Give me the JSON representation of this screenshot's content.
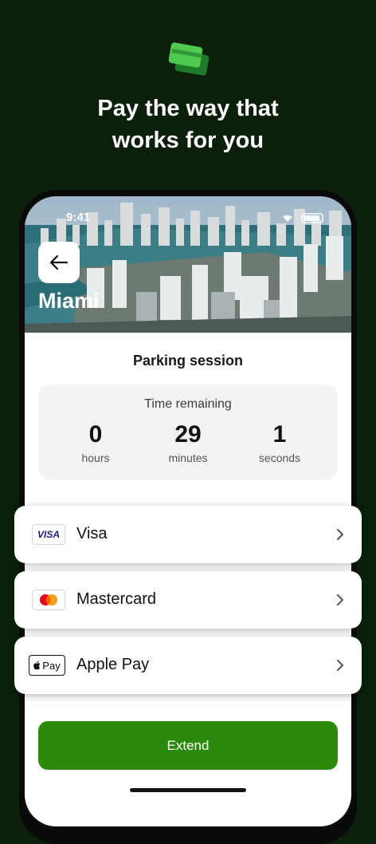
{
  "headline": {
    "line1": "Pay the way that",
    "line2": "works for you"
  },
  "status": {
    "time": "9:41"
  },
  "hero": {
    "city": "Miami"
  },
  "session": {
    "title": "Parking session",
    "time_remaining_label": "Time remaining",
    "hours": "0",
    "hours_label": "hours",
    "minutes": "29",
    "minutes_label": "minutes",
    "seconds": "1",
    "seconds_label": "seconds"
  },
  "payment_methods": [
    {
      "label": "Visa",
      "logo_text": "VISA"
    },
    {
      "label": "Mastercard"
    },
    {
      "label": "Apple Pay",
      "logo_text": "Pay"
    }
  ],
  "extend_label": "Extend",
  "colors": {
    "background": "#0b1f0b",
    "accent": "#2c8a0a",
    "card_green": "#4fc94f"
  }
}
